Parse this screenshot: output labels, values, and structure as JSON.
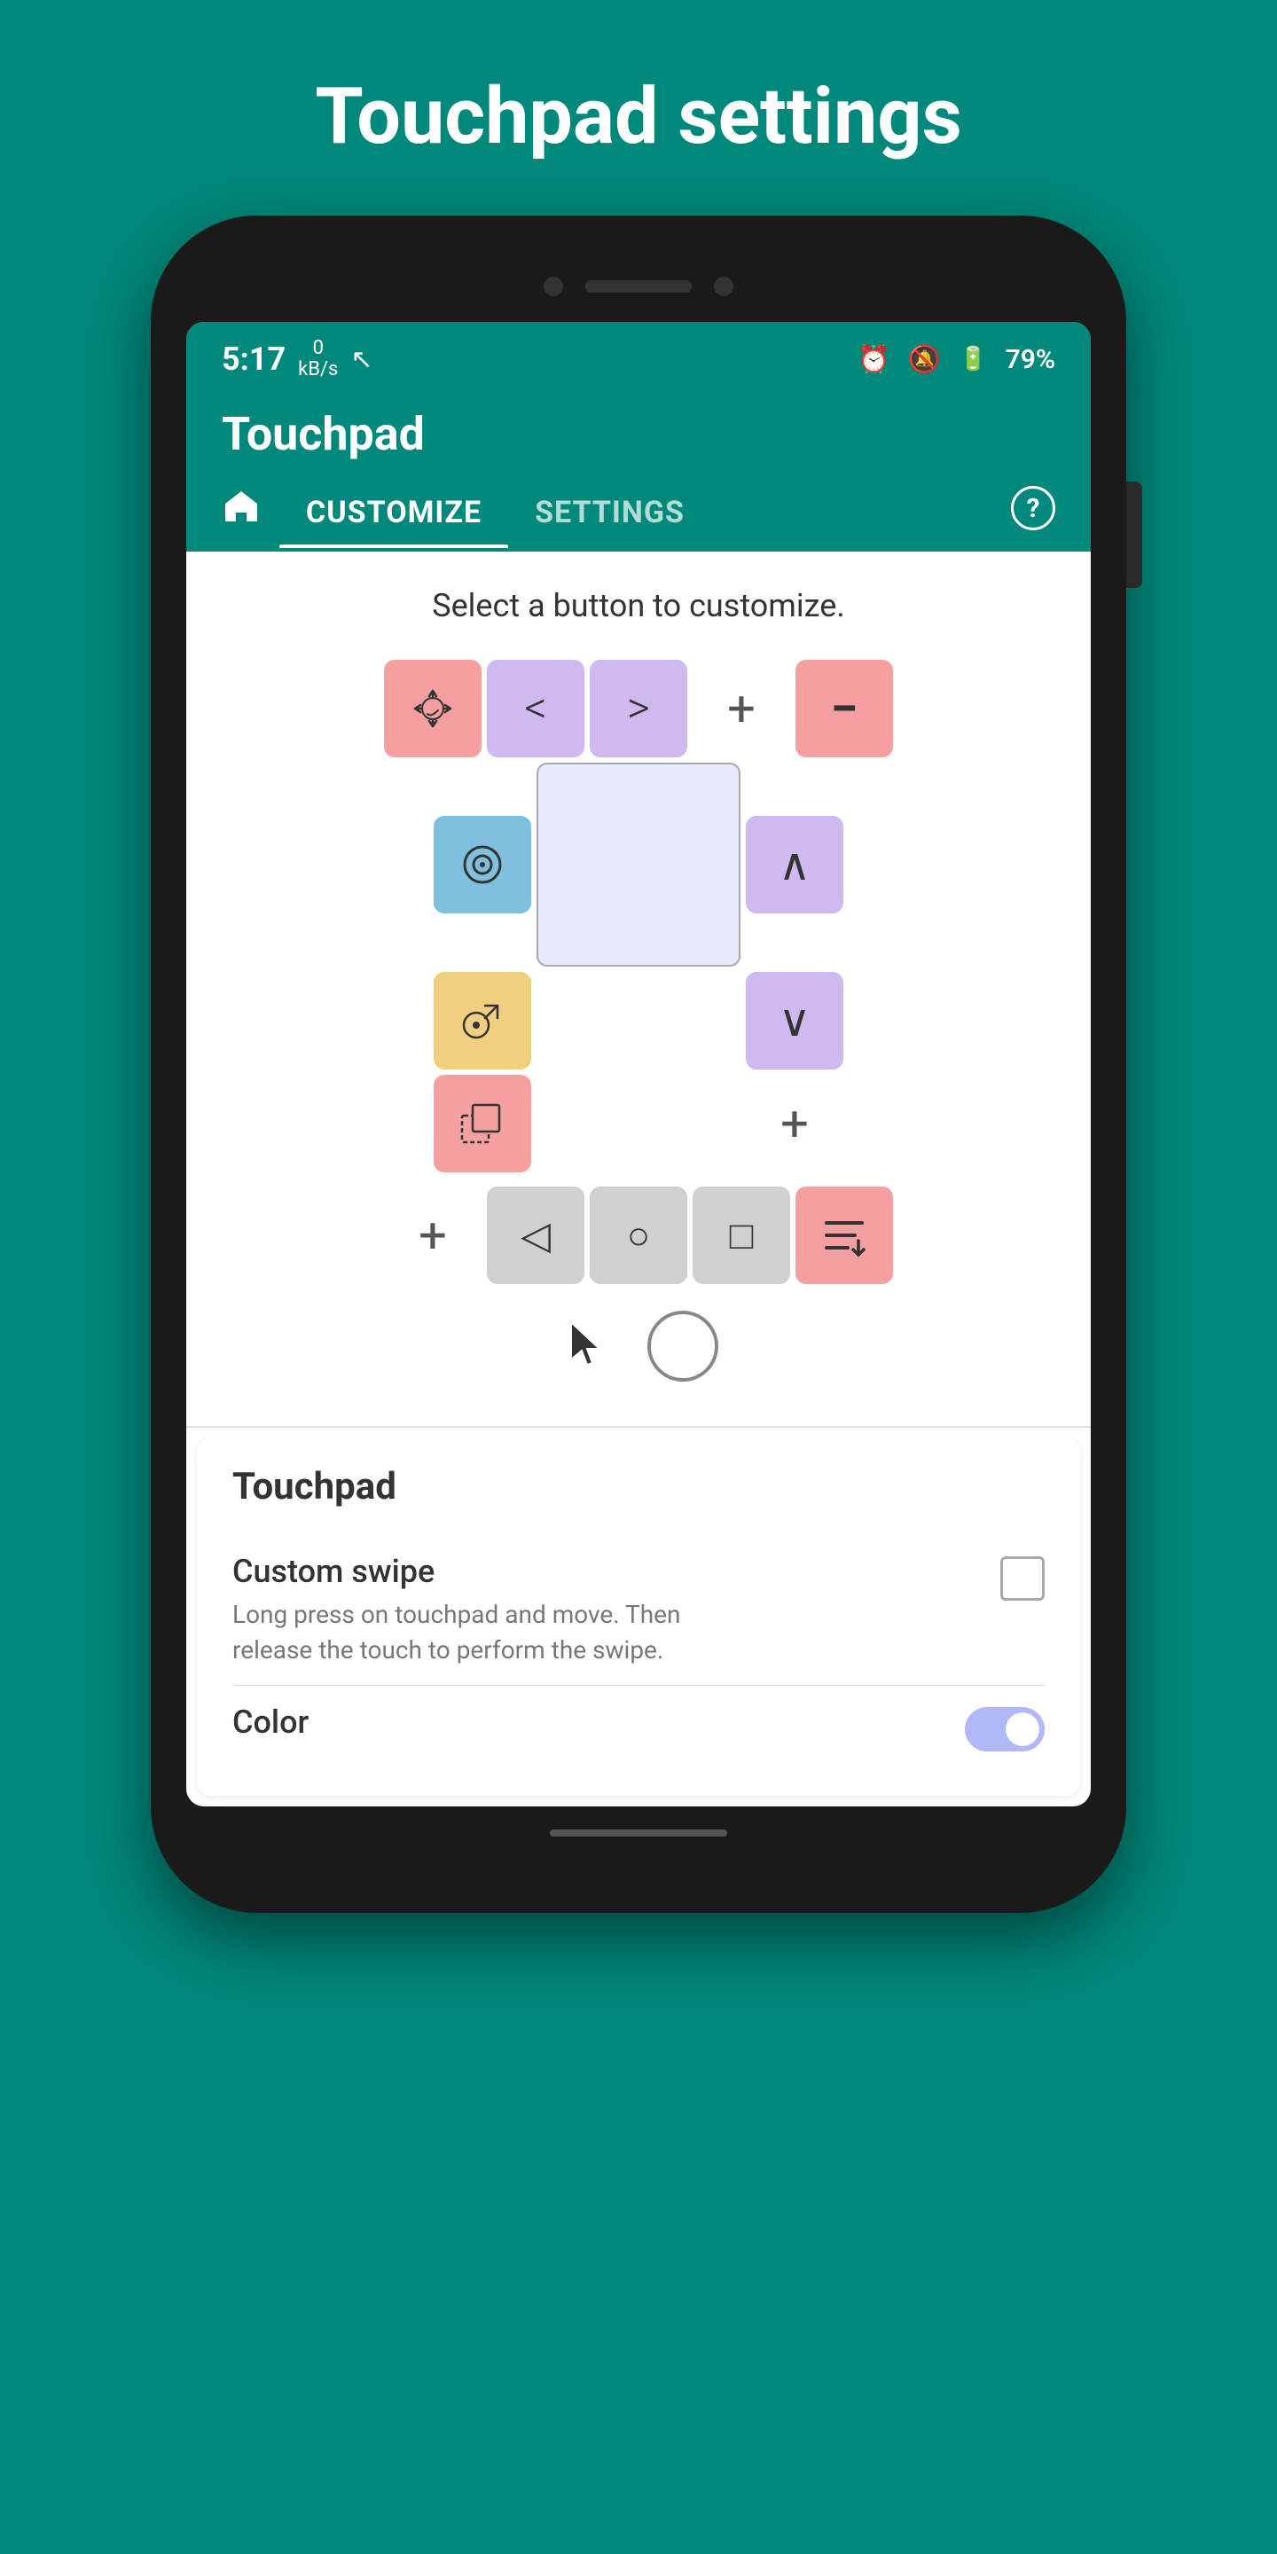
{
  "page": {
    "title": "Touchpad settings",
    "background_color": "#00897B"
  },
  "status_bar": {
    "time": "5:17",
    "data_label": "0\nkB/s",
    "battery": "79%"
  },
  "app_header": {
    "title": "Touchpad"
  },
  "tabs": {
    "home_label": "🏠",
    "customize_label": "CUSTOMIZE",
    "settings_label": "SETTINGS",
    "help_label": "?"
  },
  "customize_section": {
    "prompt": "Select a button to customize.",
    "buttons": {
      "row1": [
        {
          "icon": "☩",
          "color": "pink",
          "name": "move-button"
        },
        {
          "icon": "‹",
          "color": "purple",
          "name": "left-button"
        },
        {
          "icon": "›",
          "color": "purple",
          "name": "right-button"
        },
        {
          "icon": "+",
          "color": "none",
          "name": "add-button-1"
        },
        {
          "icon": "−",
          "color": "pink",
          "name": "minus-button"
        }
      ],
      "row2_left": [
        {
          "icon": "⊙",
          "color": "blue",
          "name": "record-button"
        }
      ],
      "center": {
        "name": "center-touchpad"
      },
      "row2_right": [
        {
          "icon": "∧",
          "color": "purple",
          "name": "up-button"
        }
      ],
      "row3_left": [
        {
          "icon": "⊙➚",
          "color": "yellow",
          "name": "goto-button"
        }
      ],
      "row3_right": [
        {
          "icon": "∨",
          "color": "purple",
          "name": "down-button"
        }
      ],
      "row4_left": [
        {
          "icon": "⊡",
          "color": "pink",
          "name": "select-button"
        }
      ],
      "row4_right": [
        {
          "icon": "+",
          "color": "none",
          "name": "add-button-2"
        }
      ],
      "bottom_row": [
        {
          "icon": "+",
          "color": "none",
          "name": "add-button-3"
        },
        {
          "icon": "◁",
          "color": "gray",
          "name": "back-button"
        },
        {
          "icon": "○",
          "color": "gray",
          "name": "home-button"
        },
        {
          "icon": "□",
          "color": "gray",
          "name": "recent-button"
        },
        {
          "icon": "↡≡",
          "color": "pink",
          "name": "menu-button"
        }
      ]
    },
    "cursor_icon": "↖",
    "circle_icon": "○"
  },
  "touchpad_settings": {
    "section_title": "Touchpad",
    "custom_swipe": {
      "label": "Custom swipe",
      "description": "Long press on touchpad and move. Then release the touch to perform the swipe.",
      "checked": false
    },
    "color": {
      "label": "Color",
      "enabled": true
    }
  }
}
